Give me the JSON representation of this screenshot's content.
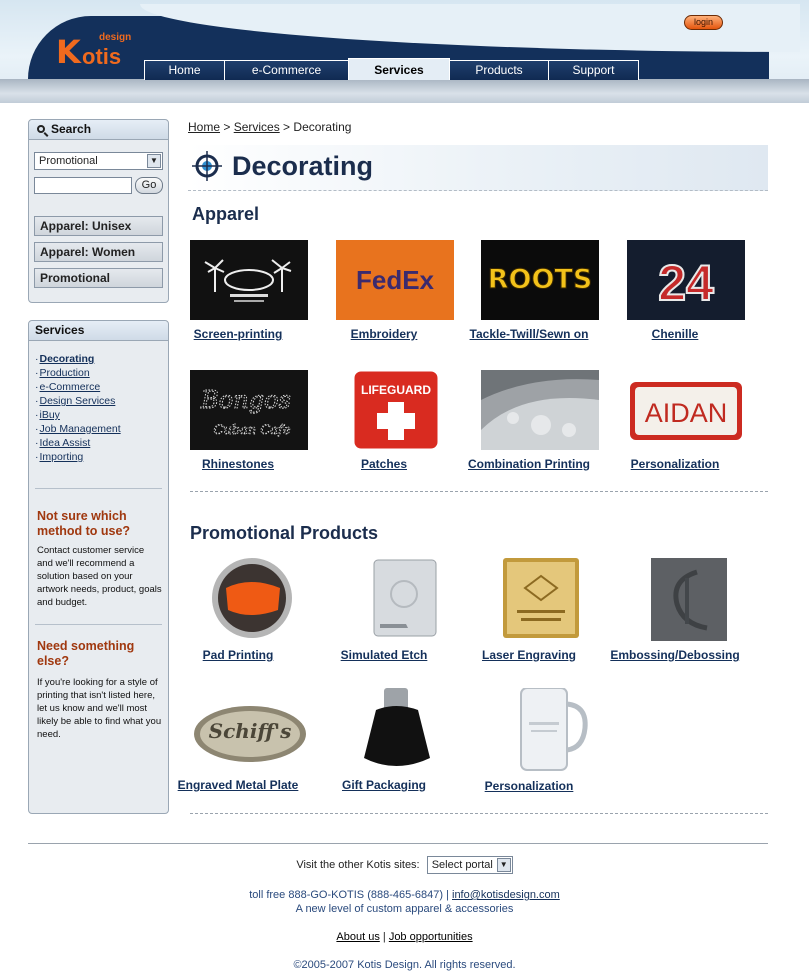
{
  "header": {
    "logo": {
      "mark": "K",
      "brand": "otis",
      "sub": "design"
    },
    "login_label": "login",
    "nav": [
      {
        "label": "Home"
      },
      {
        "label": "e-Commerce"
      },
      {
        "label": "Services",
        "active": true
      },
      {
        "label": "Products"
      },
      {
        "label": "Support"
      }
    ]
  },
  "sidebar": {
    "search": {
      "heading": "Search",
      "select_value": "Promotional",
      "input_value": "",
      "go_label": "Go",
      "categories": [
        "Apparel: Unisex",
        "Apparel: Women",
        "Promotional"
      ]
    },
    "services": {
      "heading": "Services",
      "items": [
        "Decorating",
        "Production",
        "e-Commerce",
        "Design Services",
        "iBuy",
        "Job Management",
        "Idea Assist",
        "Importing"
      ],
      "current": "Decorating",
      "help1_title": "Not sure which method to use?",
      "help1_body": "Contact customer service and we'll recommend a solution based on your artwork needs, product, goals and budget.",
      "help2_title": "Need something else?",
      "help2_body": "If you're looking for a style of printing that isn't listed here, let us know and we'll most likely be able to find what you need."
    }
  },
  "breadcrumb": {
    "home": "Home",
    "sep1": " > ",
    "services": "Services",
    "sep2": " > ",
    "current": "Decorating"
  },
  "page_title": "Decorating",
  "apparel": {
    "heading": "Apparel",
    "items": [
      {
        "label": "Screen-printing"
      },
      {
        "label": "Embroidery",
        "thumb_text": "FedEx"
      },
      {
        "label": "Tackle-Twill/Sewn on",
        "thumb_text": "ROOTS"
      },
      {
        "label": "Chenille",
        "thumb_text": "24"
      },
      {
        "label": "Rhinestones",
        "thumb_text": "Bongos",
        "thumb_sub": "Cuban Cafe"
      },
      {
        "label": "Patches",
        "thumb_text": "LIFEGUARD"
      },
      {
        "label": "Combination Printing"
      },
      {
        "label": "Personalization",
        "thumb_text": "AIDAN"
      }
    ]
  },
  "promotional": {
    "heading": "Promotional Products",
    "items": [
      {
        "label": "Pad Printing"
      },
      {
        "label": "Simulated Etch"
      },
      {
        "label": "Laser Engraving"
      },
      {
        "label": "Embossing/Debossing"
      },
      {
        "label": "Engraved Metal Plate",
        "thumb_text": "Schiff's"
      },
      {
        "label": "Gift Packaging"
      },
      {
        "label": "Personalization"
      }
    ]
  },
  "footer": {
    "visit_label": "Visit the other Kotis sites:",
    "portal_select": "Select portal",
    "phone": "toll free 888-GO-KOTIS (888-465-6847) | ",
    "email": "info@kotisdesign.com",
    "tagline": "A new level of custom apparel & accessories",
    "about": "About us",
    "sep": " | ",
    "jobs": "Job opportunities",
    "copyright": "©2005-2007 Kotis Design. All rights reserved."
  },
  "colors": {
    "navy": "#13305b",
    "orange": "#f06a1e",
    "heading": "#1b2d4d",
    "help_title": "#a0380f"
  }
}
